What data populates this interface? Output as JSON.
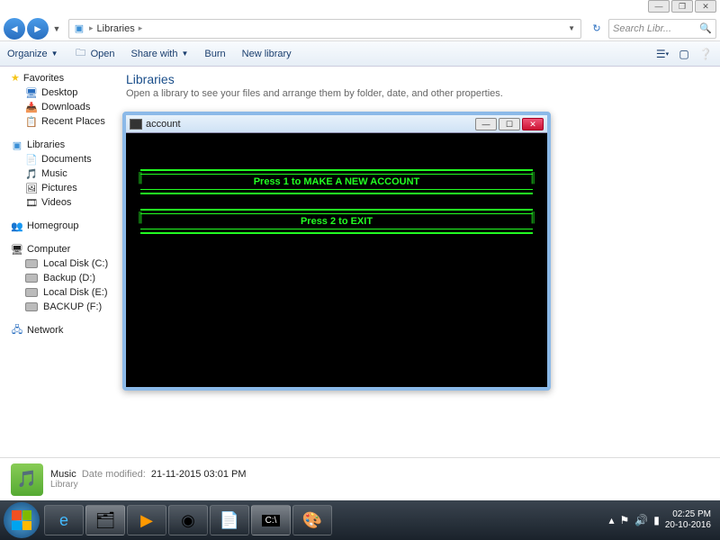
{
  "window_controls": {
    "min": "—",
    "max": "☐",
    "close": "✕"
  },
  "nav": {
    "breadcrumb_root": "Libraries",
    "search_placeholder": "Search Libr..."
  },
  "toolbar": {
    "organize": "Organize",
    "open": "Open",
    "share": "Share with",
    "burn": "Burn",
    "newlib": "New library"
  },
  "sidebar": {
    "favorites": "Favorites",
    "desktop": "Desktop",
    "downloads": "Downloads",
    "recent": "Recent Places",
    "libraries": "Libraries",
    "documents": "Documents",
    "music": "Music",
    "pictures": "Pictures",
    "videos": "Videos",
    "homegroup": "Homegroup",
    "computer": "Computer",
    "drive_c": "Local Disk (C:)",
    "drive_d": "Backup (D:)",
    "drive_e": "Local Disk  (E:)",
    "drive_f": "BACKUP (F:)",
    "network": "Network"
  },
  "main": {
    "title": "Libraries",
    "subtitle": "Open a library to see your files and arrange them by folder, date, and other properties."
  },
  "console": {
    "title": "account",
    "line1": "Press 1 to MAKE A NEW ACCOUNT",
    "line2": "Press 2 to EXIT"
  },
  "details": {
    "name": "Music",
    "modified_label": "Date modified:",
    "modified": "21-11-2015  03:01 PM",
    "type": "Library"
  },
  "taskbar": {
    "time": "02:25 PM",
    "date": "20-10-2016"
  }
}
